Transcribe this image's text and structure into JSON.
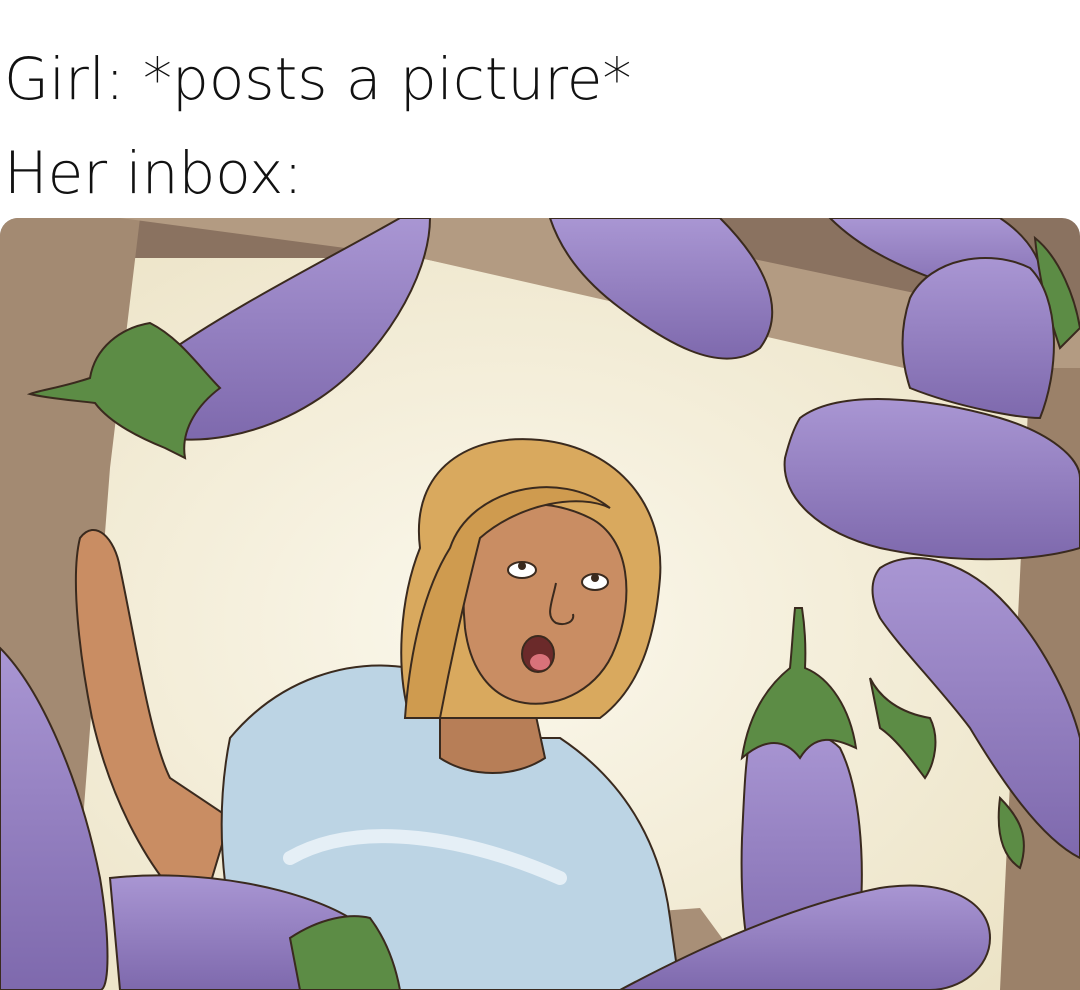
{
  "meme": {
    "caption_line1": "Girl: *posts a picture*",
    "caption_line2": "Her inbox:"
  },
  "colors": {
    "background": "#ffffff",
    "caption_text": "#111111",
    "box_wood": "#a78e77",
    "box_inner": "#f4eedb",
    "eggplant": "#9a86c6",
    "eggplant_shadow": "#7f6aaf",
    "stem": "#5c8c45",
    "hair": "#d9a95e",
    "skin": "#c98d63",
    "shirt": "#bcd4e4"
  }
}
